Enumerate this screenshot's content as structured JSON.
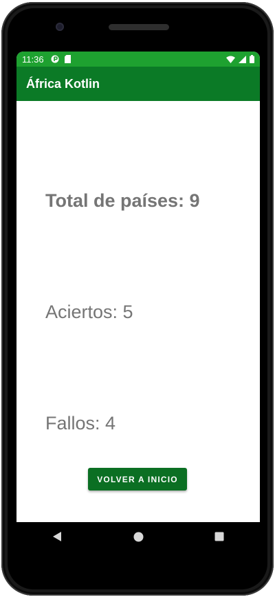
{
  "statusbar": {
    "time": "11:36"
  },
  "appbar": {
    "title": "África Kotlin"
  },
  "results": {
    "total": "Total de países: 9",
    "aciertos": "Aciertos: 5",
    "fallos": "Fallos: 4"
  },
  "actions": {
    "back_home": "VOLVER A INICIO"
  },
  "navbar": {
    "icons": [
      "back-icon",
      "home-icon",
      "recents-icon"
    ]
  },
  "colors": {
    "statusbar": "#1ea130",
    "appbar": "#0b7a26",
    "button": "#0b6f23",
    "text": "#757575"
  }
}
